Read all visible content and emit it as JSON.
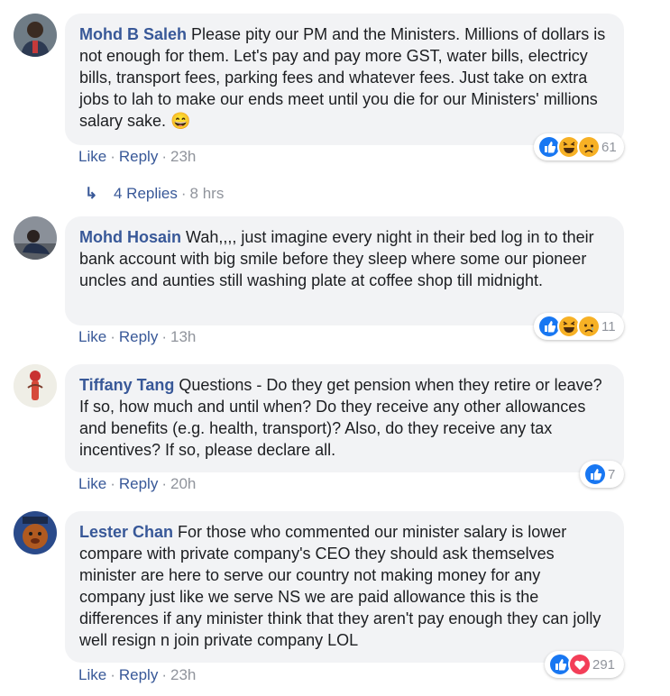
{
  "comments": [
    {
      "author": "Mohd B Saleh",
      "text": "Please pity our PM and the Ministers. Millions of dollars is not enough for them. Let's pay and pay more GST, water bills, electricy bills, transport fees, parking fees and whatever fees. Just take on extra jobs to lah to make our ends meet until you die for our Ministers' millions salary sake. 😄",
      "like": "Like",
      "reply": "Reply",
      "time": "23h",
      "reaction_count": "61",
      "reaction_icons": [
        "like-icon",
        "haha-icon",
        "sad-icon"
      ]
    },
    {
      "author": "Mohd Hosain",
      "text": "Wah,,,, just imagine every night in their bed log in to their bank account with big smile before they sleep where some our pioneer uncles and aunties still washing plate at coffee shop till midnight.",
      "like": "Like",
      "reply": "Reply",
      "time": "13h",
      "reaction_count": "11",
      "reaction_icons": [
        "like-icon",
        "haha-icon",
        "sad-icon"
      ]
    },
    {
      "author": "Tiffany Tang",
      "text": "Questions - Do they get pension when they retire or leave? If so, how much and until when? Do they receive any other allowances and benefits (e.g. health, transport)? Also, do they receive any tax incentives? If so, please declare all.",
      "like": "Like",
      "reply": "Reply",
      "time": "20h",
      "reaction_count": "7",
      "reaction_icons": [
        "like-icon"
      ]
    },
    {
      "author": "Lester Chan",
      "text": "For those who commented our minister salary is lower compare with private company's CEO they should ask themselves minister are here to serve our country not making money for any company just like we serve NS we are paid allowance this is the differences if any minister think that they aren't pay enough they can jolly well resign n join private company LOL",
      "like": "Like",
      "reply": "Reply",
      "time": "23h",
      "reaction_count": "291",
      "reaction_icons": [
        "like-icon",
        "love-icon"
      ]
    }
  ],
  "replies": {
    "label": "4 Replies",
    "time": "8 hrs"
  },
  "colors": {
    "author": "#385898",
    "bubble": "#f2f3f5",
    "meta": "#90949c",
    "like_blue": "#1877f2",
    "haha_yellow": "#f7b125",
    "love_red": "#f33e58"
  }
}
